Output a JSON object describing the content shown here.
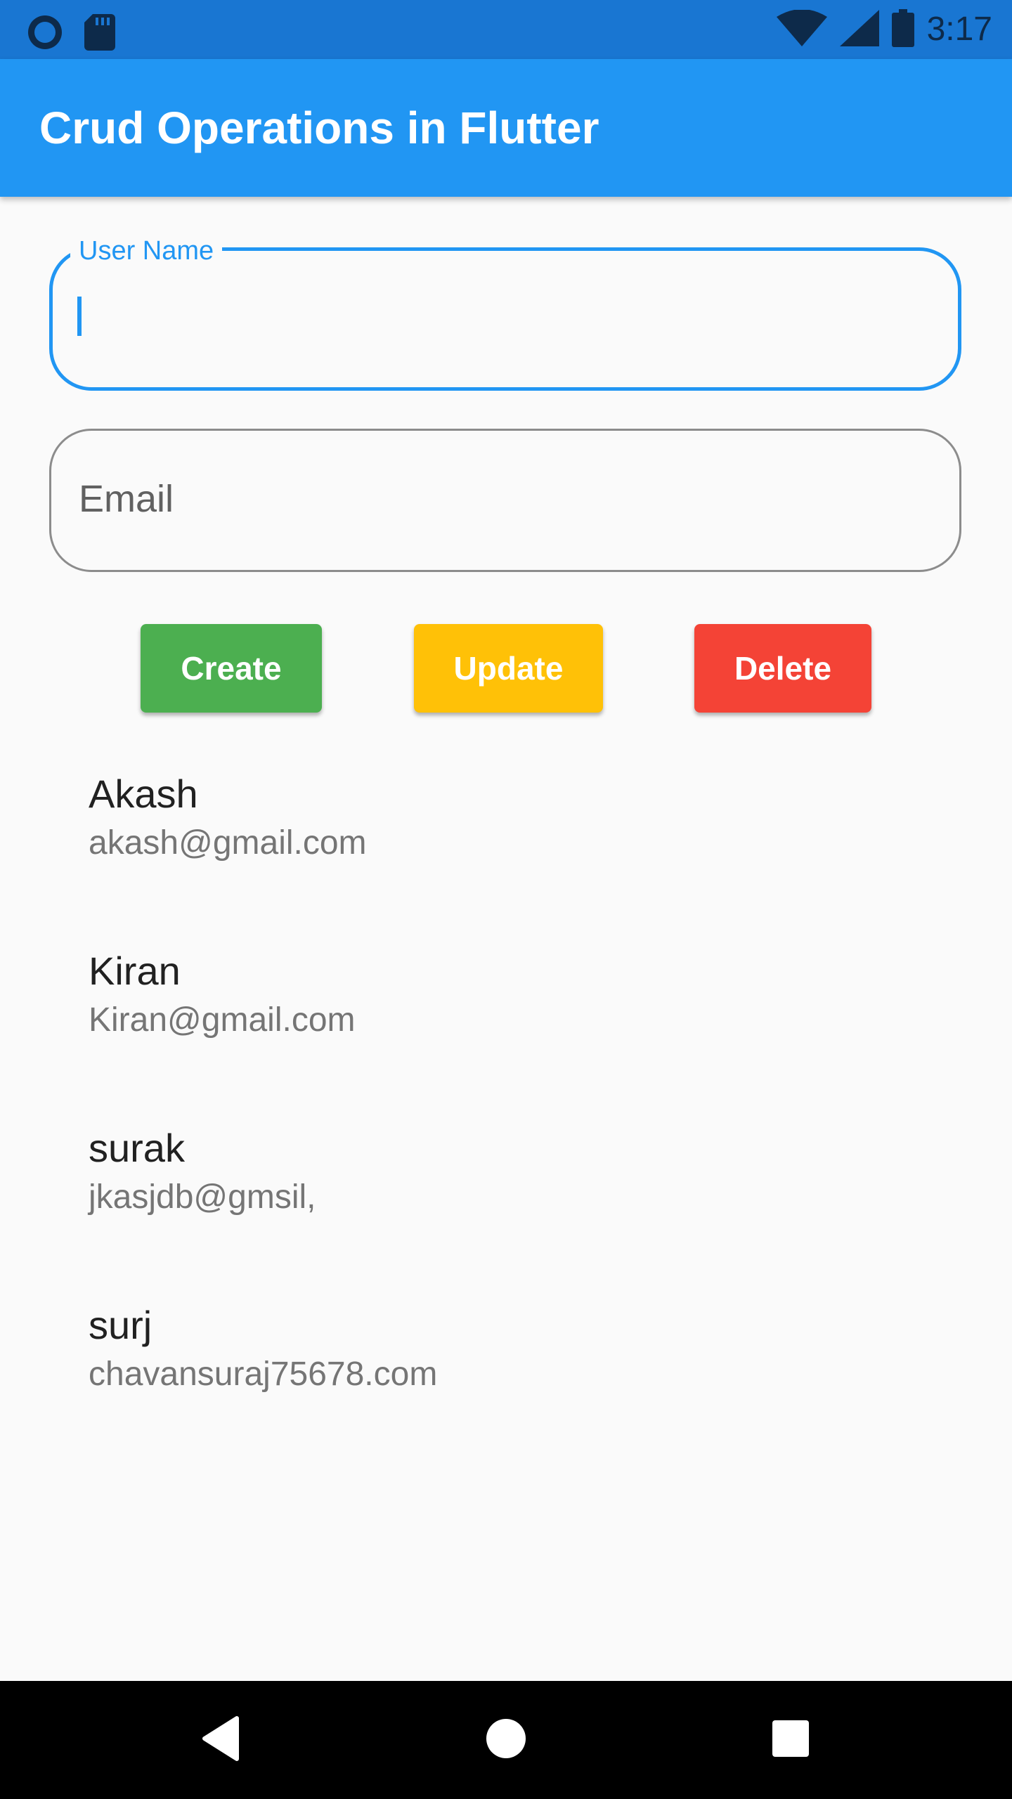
{
  "status_bar": {
    "time": "3:17",
    "left_icons": [
      "circle-icon",
      "sd-card-icon"
    ],
    "right_icons": [
      "wifi-icon",
      "cellular-signal-icon",
      "battery-icon"
    ]
  },
  "app_bar": {
    "title": "Crud Operations in Flutter"
  },
  "form": {
    "username": {
      "label": "User Name",
      "value": ""
    },
    "email": {
      "placeholder": "Email",
      "value": ""
    }
  },
  "buttons": {
    "create": "Create",
    "update": "Update",
    "delete": "Delete"
  },
  "users": [
    {
      "name": "Akash",
      "email": "akash@gmail.com"
    },
    {
      "name": "Kiran",
      "email": "Kiran@gmail.com"
    },
    {
      "name": "surak",
      "email": "jkasjdb@gmsil,"
    },
    {
      "name": "surj",
      "email": "chavansuraj75678.com"
    }
  ],
  "navigation_bar": {
    "icons": [
      "back-icon",
      "home-icon",
      "recents-icon"
    ]
  },
  "colors": {
    "status_bar": "#1976d2",
    "app_bar": "#2196f3",
    "create": "#4caf50",
    "update": "#ffc107",
    "delete": "#f44336",
    "background": "#fafafa"
  }
}
